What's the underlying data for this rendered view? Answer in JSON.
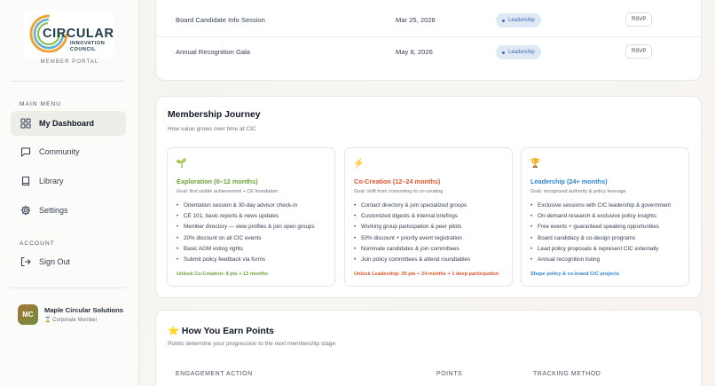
{
  "sidebar": {
    "logo": {
      "name": "CIRCULAR",
      "line1": "INNOVATION",
      "line2": "COUNCIL"
    },
    "portal_label": "MEMBER PORTAL",
    "main_menu_label": "MAIN MENU",
    "items": [
      {
        "label": "My Dashboard",
        "icon": "grid-icon",
        "active": true
      },
      {
        "label": "Community",
        "icon": "chat-icon",
        "active": false
      },
      {
        "label": "Library",
        "icon": "book-icon",
        "active": false
      },
      {
        "label": "Settings",
        "icon": "gear-icon",
        "active": false
      }
    ],
    "account_label": "ACCOUNT",
    "sign_out": "Sign Out",
    "org": {
      "initials": "MC",
      "name": "Maple Circular Solutions",
      "tier": "Corporate Member",
      "tier_icon": "hourglass-icon"
    }
  },
  "events": [
    {
      "name": "Board Candidate Info Session",
      "date": "Mar 25, 2026",
      "tag": "Leadership",
      "action": "RSVP"
    },
    {
      "name": "Annual Recognition Gala",
      "date": "May 8, 2026",
      "tag": "Leadership",
      "action": "RSVP"
    }
  ],
  "journey": {
    "title": "Membership Journey",
    "subtitle": "How value grows over time at CIC",
    "stages": [
      {
        "icon": "🌱",
        "title": "Exploration (0–12 months)",
        "goal": "Goal: first visible achievement + CE foundation",
        "color": "#6aa33a",
        "items": [
          "Orientation session & 30-day advisor check-in",
          "CE 101, basic reports & news updates",
          "Member directory — view profiles & join open groups",
          "20% discount on all CIC events",
          "Basic AGM voting rights",
          "Submit policy feedback via forms"
        ],
        "unlock": "Unlock Co-Creation: 8 pts + 12 months"
      },
      {
        "icon": "⚡",
        "title": "Co-Creation (12–24 months)",
        "goal": "Goal: shift from consuming to co-creating",
        "color": "#e0542b",
        "items": [
          "Contact directory & join specialized groups",
          "Customized digests & internal briefings",
          "Working group participation & peer pilots",
          "50% discount + priority event registration",
          "Nominate candidates & join committees",
          "Join policy committees & attend roundtables"
        ],
        "unlock": "Unlock Leadership: 20 pts + 24 months + 1 deep participation"
      },
      {
        "icon": "🏆",
        "title": "Leadership (24+ months)",
        "goal": "Goal: recognized authority & policy leverage",
        "color": "#2f86d6",
        "items": [
          "Exclusive sessions with CIC leadership & government",
          "On-demand research & exclusive policy insights",
          "Free events + guaranteed speaking opportunities",
          "Board candidacy & co-design programs",
          "Lead policy proposals & represent CIC externally",
          "Annual recognition listing"
        ],
        "unlock": "Shape policy & co-brand CIC projects"
      }
    ]
  },
  "points": {
    "icon": "⭐",
    "title": "How You Earn Points",
    "subtitle": "Points determine your progression to the next membership stage",
    "columns": [
      "ENGAGEMENT ACTION",
      "POINTS",
      "TRACKING METHOD"
    ]
  }
}
